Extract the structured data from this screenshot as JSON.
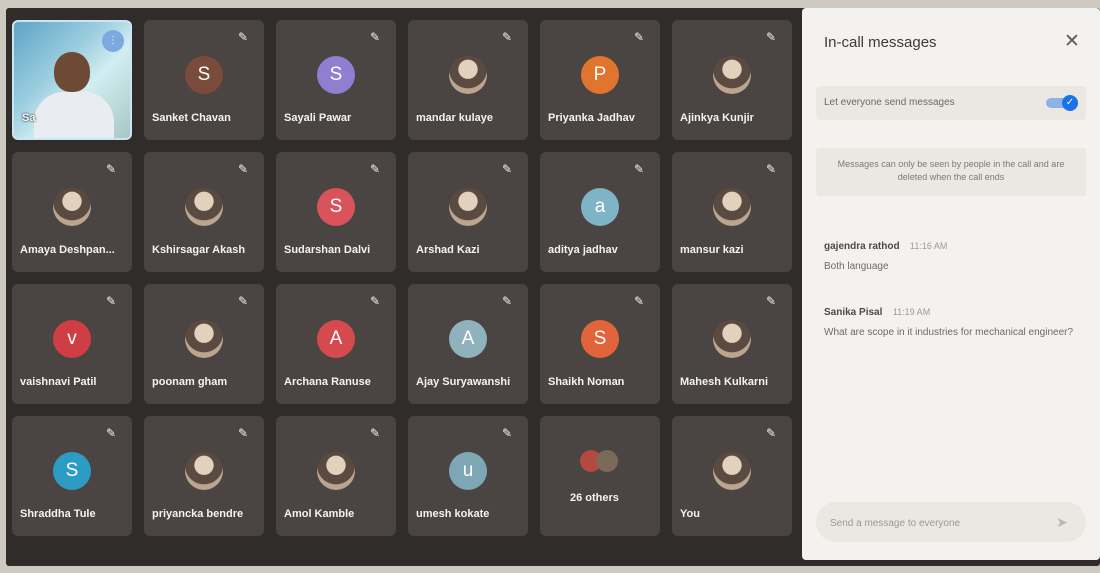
{
  "self_tile": {
    "label": "Sa",
    "menu_icon": "more-options-icon"
  },
  "participants": [
    {
      "name": "Sanket Chavan",
      "initial": "S",
      "color": "#7a4a3a",
      "pinned": true
    },
    {
      "name": "Sayali Pawar",
      "initial": "S",
      "color": "#8e7fd0",
      "pinned": true
    },
    {
      "name": "mandar kulaye",
      "initial": "",
      "color": "",
      "photo": true,
      "pinned": true
    },
    {
      "name": "Priyanka Jadhav",
      "initial": "P",
      "color": "#e0762d",
      "pinned": true
    },
    {
      "name": "Ajinkya Kunjir",
      "initial": "",
      "color": "",
      "photo": true,
      "pinned": true
    },
    {
      "name": "Amaya Deshpan...",
      "initial": "",
      "color": "",
      "photo": true,
      "pinned": true
    },
    {
      "name": "Kshirsagar Akash",
      "initial": "",
      "color": "",
      "photo": true,
      "pinned": true
    },
    {
      "name": "Sudarshan Dalvi",
      "initial": "S",
      "color": "#d9535a",
      "pinned": true
    },
    {
      "name": "Arshad Kazi",
      "initial": "",
      "color": "",
      "photo": true,
      "pinned": true
    },
    {
      "name": "aditya jadhav",
      "initial": "a",
      "color": "#7fb4c6",
      "pinned": true
    },
    {
      "name": "mansur kazi",
      "initial": "",
      "color": "",
      "photo": true,
      "pinned": true
    },
    {
      "name": "vaishnavi Patil",
      "initial": "v",
      "color": "#cf3d45",
      "pinned": true
    },
    {
      "name": "poonam gham",
      "initial": "",
      "color": "",
      "photo": true,
      "pinned": true
    },
    {
      "name": "Archana Ranuse",
      "initial": "A",
      "color": "#d54a4e",
      "pinned": true
    },
    {
      "name": "Ajay Suryawanshi",
      "initial": "A",
      "color": "#8fb2bd",
      "pinned": true
    },
    {
      "name": "Shaikh Noman",
      "initial": "S",
      "color": "#e2643b",
      "pinned": true
    },
    {
      "name": "Mahesh Kulkarni",
      "initial": "",
      "color": "",
      "photo": true,
      "pinned": true
    },
    {
      "name": "Shraddha Tule",
      "initial": "S",
      "color": "#2c9cc4",
      "pinned": true
    },
    {
      "name": "priyancka bendre",
      "initial": "",
      "color": "",
      "photo": true,
      "pinned": true
    },
    {
      "name": "Amol Kamble",
      "initial": "",
      "color": "",
      "photo": true,
      "pinned": true
    },
    {
      "name": "umesh kokate",
      "initial": "u",
      "color": "#7ea7b6",
      "pinned": true
    },
    {
      "name": "26 others",
      "initial": "",
      "color": "",
      "others": true,
      "pinned": false
    },
    {
      "name": "You",
      "initial": "",
      "color": "",
      "photo": true,
      "pinned": true
    }
  ],
  "chat_panel": {
    "title": "In-call messages",
    "close_icon": "close-icon",
    "toggle_label": "Let everyone send messages",
    "toggle_on": true,
    "notice": "Messages can only be seen by people in the call and are deleted when the call ends",
    "messages": [
      {
        "sender": "gajendra rathod",
        "time": "11:16 AM",
        "text": "Both language"
      },
      {
        "sender": "Sanika Pisal",
        "time": "11:19 AM",
        "text": "What are scope in it industries for mechanical engineer?"
      }
    ],
    "composer_placeholder": "Send a message to everyone",
    "send_icon": "send-icon"
  }
}
